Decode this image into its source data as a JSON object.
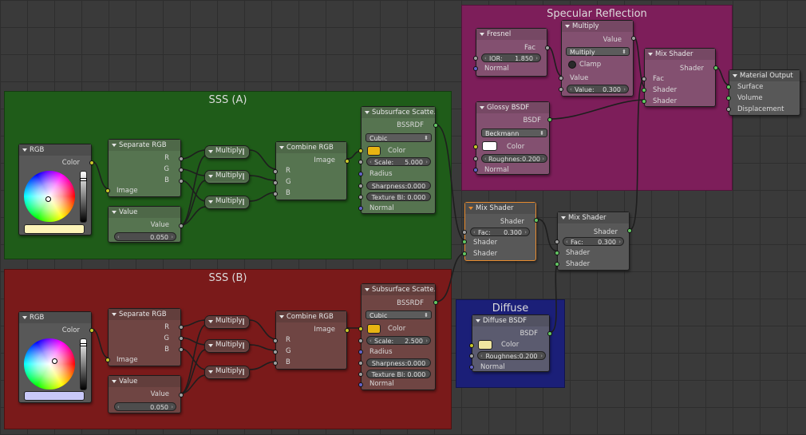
{
  "frames": {
    "sss_a": "SSS (A)",
    "sss_b": "SSS (B)",
    "specular": "Specular Reflection",
    "diffuse": "Diffuse"
  },
  "labels": {
    "rgb": "RGB",
    "color": "Color",
    "separate_rgb": "Separate RGB",
    "r": "R",
    "g": "G",
    "b": "B",
    "image": "Image",
    "value": "Value",
    "multiply": "Multiply",
    "combine_rgb": "Combine RGB",
    "subsurface": "Subsurface Scatte...",
    "bssrdf": "BSSRDF",
    "radius": "Radius",
    "normal": "Normal",
    "mix_shader": "Mix Shader",
    "shader": "Shader",
    "fac": "Fac",
    "fresnel": "Fresnel",
    "clamp": "Clamp",
    "glossy_bsdf": "Glossy BSDF",
    "bsdf": "BSDF",
    "material_output": "Material Output",
    "surface": "Surface",
    "volume": "Volume",
    "displacement": "Displacement",
    "diffuse_bsdf": "Diffuse BSDF"
  },
  "sss_a": {
    "falloff": "Cubic",
    "scale_label": "Scale:",
    "scale": "5.000",
    "sharpness": "Sharpness:0.000",
    "texture_blur": "Texture Bl: 0.000",
    "value": "0.050"
  },
  "sss_b": {
    "falloff": "Cubic",
    "scale_label": "Scale:",
    "scale": "2.500",
    "sharpness": "Sharpness:0.000",
    "texture_blur": "Texture Bl: 0.000",
    "value": "0.050"
  },
  "fresnel": {
    "ior_label": "IOR:",
    "ior": "1.850"
  },
  "multiply_spec": {
    "mode": "Multiply",
    "value_label": "Value:",
    "value": "0.300"
  },
  "glossy": {
    "distribution": "Beckmann",
    "roughness": "Roughnes:0.200"
  },
  "mix_center": {
    "fac_label": "Fac:",
    "fac": "0.300"
  },
  "mix_right": {
    "fac_label": "Fac:",
    "fac": "0.300"
  },
  "diffuse": {
    "roughness": "Roughnes:0.200"
  },
  "colors": {
    "frame_sss_a": "#1f5c19",
    "frame_sss_b": "#7a1a1a",
    "frame_specular": "#7d1e5a",
    "frame_diffuse": "#1b1f78",
    "rgb_a_swatch": "#fdf4b8",
    "rgb_b_swatch": "#c8c8f8",
    "sss_color": "#e8b412",
    "glossy_color": "#ffffff",
    "diffuse_color": "#f0e6a0",
    "wire": "#1e1e1e",
    "selected_outline": "#e68a2e"
  },
  "icons": {
    "collapse": "collapse-triangle-icon",
    "dropdown": "dropdown-chevron-icon"
  }
}
